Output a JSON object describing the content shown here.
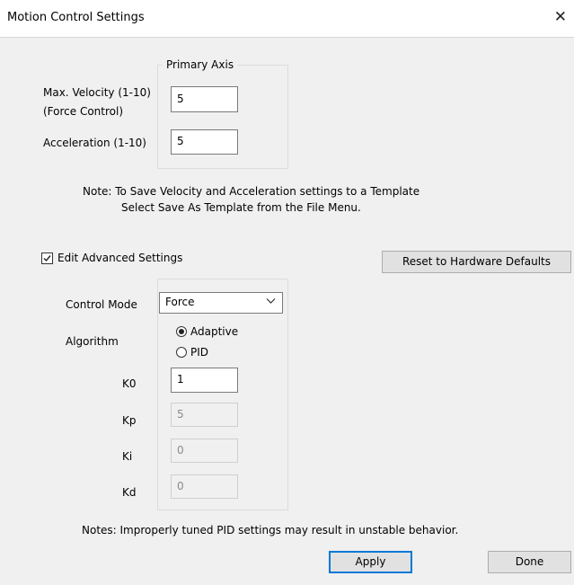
{
  "window": {
    "title": "Motion Control Settings",
    "close_glyph": "✕"
  },
  "primary_axis": {
    "group_label": "Primary Axis",
    "velocity_label_line1": "Max. Velocity (1-10)",
    "velocity_label_line2": "(Force Control)",
    "velocity_value": "5",
    "acceleration_label": "Acceleration (1-10)",
    "acceleration_value": "5"
  },
  "note": {
    "line1": "Note:  To Save Velocity and Acceleration settings to a Template",
    "line2": "Select Save As Template from the File Menu."
  },
  "advanced": {
    "checkbox_label": "Edit Advanced Settings",
    "checked": true,
    "reset_button": "Reset to Hardware Defaults",
    "control_mode_label": "Control Mode",
    "control_mode_value": "Force",
    "algorithm_label": "Algorithm",
    "algorithm_options": [
      "Adaptive",
      "PID"
    ],
    "algorithm_selected": "Adaptive",
    "k0_label": "K0",
    "k0_value": "1",
    "kp_label": "Kp",
    "kp_value": "5",
    "ki_label": "Ki",
    "ki_value": "0",
    "kd_label": "Kd",
    "kd_value": "0"
  },
  "footer": {
    "notes": "Notes:  Improperly tuned PID settings may result in unstable behavior.",
    "apply_button": "Apply",
    "done_button": "Done"
  }
}
